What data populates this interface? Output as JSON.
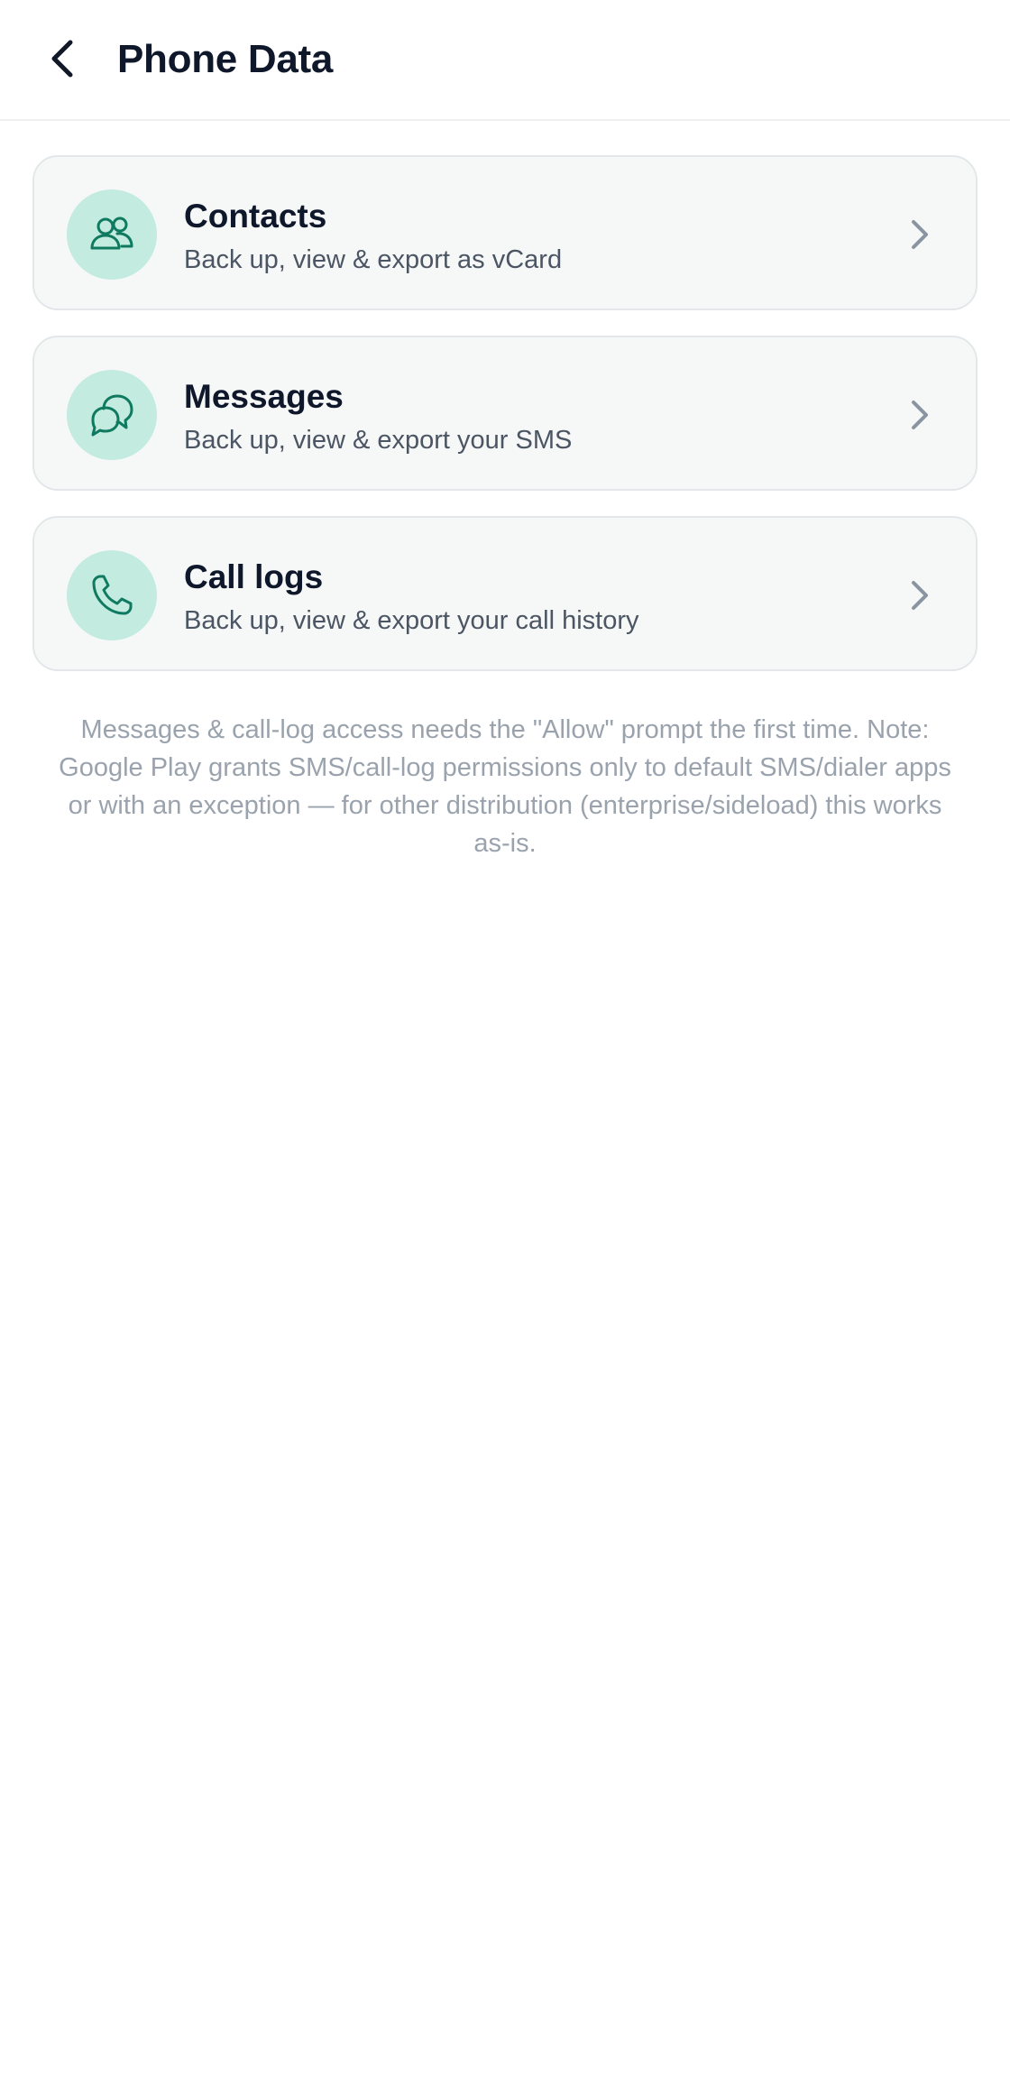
{
  "header": {
    "title": "Phone Data",
    "back_icon": "chevron-left-icon"
  },
  "items": [
    {
      "title": "Contacts",
      "subtitle": "Back up, view & export as vCard",
      "icon": "contacts-icon"
    },
    {
      "title": "Messages",
      "subtitle": "Back up, view & export your SMS",
      "icon": "messages-icon"
    },
    {
      "title": "Call logs",
      "subtitle": "Back up, view & export your call history",
      "icon": "phone-icon"
    }
  ],
  "footnote": "Messages & call-log access needs the \"Allow\" prompt the first time. Note: Google Play grants SMS/call-log permissions only to default SMS/dialer apps or with an exception — for other distribution (enterprise/sideload) this works as-is.",
  "colors": {
    "accent": "#0f7a5f",
    "icon_bg": "#c3ebdf",
    "card_bg": "#f6f8f8",
    "chevron": "#8b95a1"
  }
}
